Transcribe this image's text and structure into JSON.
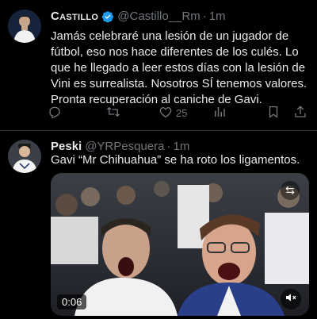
{
  "tweet1": {
    "display_name": "Castillo",
    "handle": "@Castillo__Rm",
    "separator": "·",
    "time": "1m",
    "text": "Jamás celebraré una lesión de un jugador de fútbol, eso nos hace diferentes de los culés. Lo que he llegado a leer estos días con la lesión de Vini es surrealista. Nosotros SÍ tenemos valores. Pronta recuperación al caniche de Gavi.",
    "actions": {
      "reply_count": "",
      "retweet_count": "",
      "like_count": "25",
      "views_count": ""
    }
  },
  "tweet2": {
    "display_name": "Peski",
    "handle": "@YRPesquera",
    "separator": "·",
    "time": "1m",
    "text": "Gavi “Mr Chihuahua” se ha roto los ligamentos.",
    "video": {
      "timer": "0:06"
    }
  },
  "colors": {
    "background": "#000000",
    "text": "#e7e9ea",
    "muted": "#71767b",
    "verified": "#1d9bf0",
    "divider": "#2f3336"
  }
}
